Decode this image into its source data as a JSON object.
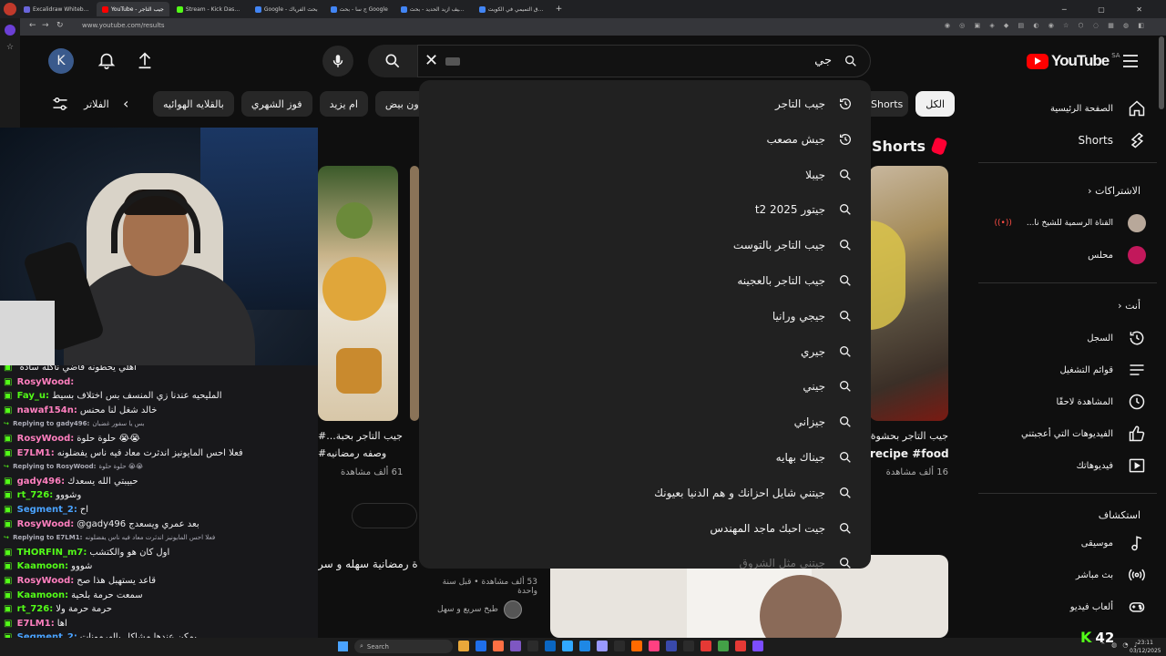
{
  "browser": {
    "tabs": [
      {
        "label": "Excalidraw Whiteboard",
        "color": "#6965db",
        "active": false
      },
      {
        "label": "YouTube - جيب التاجر",
        "color": "#ff0000",
        "active": true
      },
      {
        "label": "Stream - Kick Dashboard",
        "color": "#53fc18",
        "active": false
      },
      {
        "label": "Google - بحث الفرياك",
        "color": "#4285f4",
        "active": false
      },
      {
        "label": "ج سا - بحث Google",
        "color": "#4285f4",
        "active": false
      },
      {
        "label": "كيف ازيد الحديد - بحث Google",
        "color": "#4285f4",
        "active": false
      },
      {
        "label": "اسواق التميمي في الكويت",
        "color": "#4285f4",
        "active": false
      }
    ],
    "url": "www.youtube.com/results"
  },
  "youtube": {
    "logo": "YouTube",
    "region": "SA",
    "avatar_letter": "K",
    "search": {
      "query": "جي",
      "placeholder": ""
    },
    "chips": [
      "الكل",
      "Shorts",
      "بدون بيض",
      "ام يزيد",
      "فوز الشهري",
      "بالقلايه الهوائيه"
    ],
    "filters_label": "الفلاتر",
    "suggestions": [
      {
        "text": "جيب التاجر",
        "type": "history"
      },
      {
        "text": "جيش مصعب",
        "type": "history"
      },
      {
        "text": "جيبلا",
        "type": "search"
      },
      {
        "text": "جيتور t2 2025",
        "type": "search"
      },
      {
        "text": "جيب التاجر بالتوست",
        "type": "search"
      },
      {
        "text": "جيب التاجر بالعجينه",
        "type": "search"
      },
      {
        "text": "جيجي ورانيا",
        "type": "search"
      },
      {
        "text": "جيري",
        "type": "search"
      },
      {
        "text": "جيني",
        "type": "search"
      },
      {
        "text": "جيزاني",
        "type": "search"
      },
      {
        "text": "جيناك بهايه",
        "type": "search"
      },
      {
        "text": "جيتني شايل احزانك و هم الدنيا بعيونك",
        "type": "search"
      },
      {
        "text": "جيت احبك ماجد المهندس",
        "type": "search"
      },
      {
        "text": "جيتني مثل الشروق",
        "type": "search"
      }
    ],
    "shorts_heading": "Shorts",
    "shorts": [
      {
        "title": "جيب التاجر بحشوة...",
        "subtitle": "recipe #food#",
        "views": "16 ألف مشاهدة"
      },
      {
        "title": "جيب التاجر بحبة...#",
        "subtitle": "وصفه رمضانيه#",
        "views": "61 ألف مشاهدة"
      }
    ],
    "video": {
      "title": "ة رمضانية سهله و سر",
      "meta": "53 ألف مشاهدة • قبل سنة واحدة",
      "channel": "طبخ سريع و سهل"
    },
    "sidebar": {
      "home": "الصفحة الرئيسية",
      "shorts": "Shorts",
      "subscriptions_heading": "الاشتراكات",
      "subscriptions": [
        "القناة الرسمية للشيخ نا...",
        "محلس"
      ],
      "you_heading": "أنت",
      "you_items": [
        "السجل",
        "قوائم التشغيل",
        "المشاهدة لاحقًا",
        "الفيديوهات التي أعجبتني",
        "فيديوهاتك"
      ],
      "explore_heading": "استكشاف",
      "explore_items": [
        "موسيقى",
        "بث مباشر",
        "ألعاب فيديو"
      ]
    }
  },
  "chat": [
    {
      "reply": false,
      "user": "",
      "text": "اهلي يحطونه فاضي ناكله سادة",
      "color": "#efeff1"
    },
    {
      "reply": false,
      "user": "RosyWood:",
      "text": "",
      "color": "#ff7fbf"
    },
    {
      "reply": false,
      "user": "Fay_u:",
      "text": "المليحيه عندنا زي المنسف بس اختلاف بسيط",
      "color": "#53fc18"
    },
    {
      "reply": false,
      "user": "nawaf154n:",
      "text": "خالد شغل لنا محنس",
      "color": "#ff7fbf"
    },
    {
      "reply": true,
      "user": "Replying to gady496:",
      "text": "بس يا سفور غضبان",
      "color": "#adadb8"
    },
    {
      "reply": false,
      "user": "RosyWood:",
      "text": "حلوة حلوة 😭😭",
      "color": "#ff7fbf"
    },
    {
      "reply": false,
      "user": "E7LM1:",
      "text": "فعلا احس المايونيز اندثرت معاد فيه ناس يفضلونه",
      "color": "#ff7fbf"
    },
    {
      "reply": true,
      "user": "Replying to RosyWood:",
      "text": "حلوة حلوة 😭😭",
      "color": "#adadb8"
    },
    {
      "reply": false,
      "user": "gady496:",
      "text": "حبيبتي الله يسعدك",
      "color": "#ff7fbf"
    },
    {
      "reply": false,
      "user": "rt_726:",
      "text": "وشووو",
      "color": "#53fc18"
    },
    {
      "reply": false,
      "user": "Segment_2:",
      "text": "اح",
      "color": "#4aa3ff"
    },
    {
      "reply": false,
      "user": "RosyWood:",
      "text": "@gady496 بعد عمري ويسعدج",
      "color": "#ff7fbf"
    },
    {
      "reply": true,
      "user": "Replying to E7LM1:",
      "text": "فعلا احس المايونيز اندثرت معاد فيه ناس يفضلونه",
      "color": "#adadb8"
    },
    {
      "reply": false,
      "user": "THORFIN_m7:",
      "text": "اول كان هو والكتشب",
      "color": "#53fc18"
    },
    {
      "reply": false,
      "user": "Kaamoon:",
      "text": "شووو",
      "color": "#53fc18"
    },
    {
      "reply": false,
      "user": "RosyWood:",
      "text": "قاعد يستهبل هذا صح",
      "color": "#ff7fbf"
    },
    {
      "reply": false,
      "user": "Kaamoon:",
      "text": "سمعت حرمة بلحية",
      "color": "#53fc18"
    },
    {
      "reply": false,
      "user": "rt_726:",
      "text": "حرمة حرمة ولا",
      "color": "#53fc18"
    },
    {
      "reply": false,
      "user": "E7LM1:",
      "text": "اها",
      "color": "#ff7fbf"
    },
    {
      "reply": false,
      "user": "Segment_2:",
      "text": "يمكن عندها مشاكل بالهرمونات",
      "color": "#4aa3ff"
    }
  ],
  "taskbar": {
    "search_placeholder": "Search",
    "time": "23:11",
    "date": "03/12/2025"
  },
  "kick_viewers": "42"
}
